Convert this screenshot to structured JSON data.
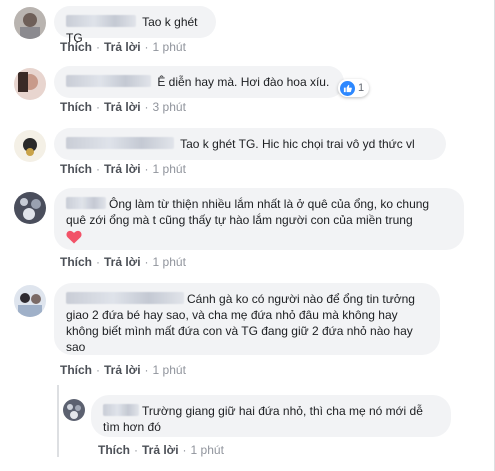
{
  "actions": {
    "like": "Thích",
    "reply": "Trả lời",
    "sep": "·"
  },
  "comments": [
    {
      "text": "Tao k ghét TG",
      "time": "1 phút"
    },
    {
      "text": "Ê diễn hay mà. Hơi đào hoa xíu.",
      "time": "3 phút",
      "likes": "1"
    },
    {
      "text": "Tao k ghét TG. Hic hic chọi trai vô yd thức vl",
      "time": "1 phút"
    },
    {
      "line1": "Ông làm từ thiện nhiều lắm nhất là ở quê của ổng, ko chung",
      "line2": "quê zới ổng mà t cũng thấy tự hào lắm người con của miền trung",
      "time": "1 phút"
    },
    {
      "line1": "Cánh gà ko có người nào để ổng tin tưởng",
      "line2": "giao 2 đứa bé hay sao, và cha mẹ đứa nhỏ đâu mà không hay",
      "line3": "không biết mình mất đứa con và TG đang giữ 2 đứa nhỏ nào hay",
      "line4": "sao",
      "time": "1 phút"
    },
    {
      "line1": "Trường giang giữ hai đứa nhỏ, thì cha mẹ nó mới dễ",
      "line2": "tìm hơn đó",
      "time": "1 phút"
    }
  ],
  "colors": {
    "link": "#4b4f56",
    "meta": "#90949c",
    "bubble": "#f2f3f5",
    "like": "#2d88ff",
    "heart": "#f25268"
  }
}
